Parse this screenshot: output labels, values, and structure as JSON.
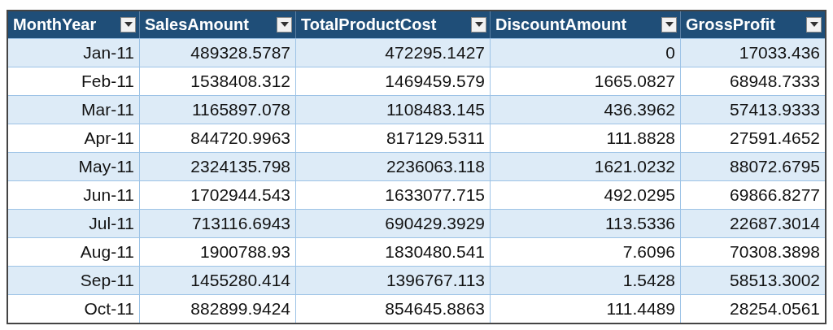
{
  "table": {
    "columns": [
      {
        "label": "MonthYear"
      },
      {
        "label": "SalesAmount"
      },
      {
        "label": "TotalProductCost"
      },
      {
        "label": "DiscountAmount"
      },
      {
        "label": "GrossProfit"
      }
    ],
    "rows": [
      [
        "Jan-11",
        "489328.5787",
        "472295.1427",
        "0",
        "17033.436"
      ],
      [
        "Feb-11",
        "1538408.312",
        "1469459.579",
        "1665.0827",
        "68948.7333"
      ],
      [
        "Mar-11",
        "1165897.078",
        "1108483.145",
        "436.3962",
        "57413.9333"
      ],
      [
        "Apr-11",
        "844720.9963",
        "817129.5311",
        "111.8828",
        "27591.4652"
      ],
      [
        "May-11",
        "2324135.798",
        "2236063.118",
        "1621.0232",
        "88072.6795"
      ],
      [
        "Jun-11",
        "1702944.543",
        "1633077.715",
        "492.0295",
        "69866.8277"
      ],
      [
        "Jul-11",
        "713116.6943",
        "690429.3929",
        "113.5336",
        "22687.3014"
      ],
      [
        "Aug-11",
        "1900788.93",
        "1830480.541",
        "7.6096",
        "70308.3898"
      ],
      [
        "Sep-11",
        "1455280.414",
        "1396767.113",
        "1.5428",
        "58513.3002"
      ],
      [
        "Oct-11",
        "882899.9424",
        "854645.8863",
        "111.4489",
        "28254.0561"
      ]
    ]
  }
}
